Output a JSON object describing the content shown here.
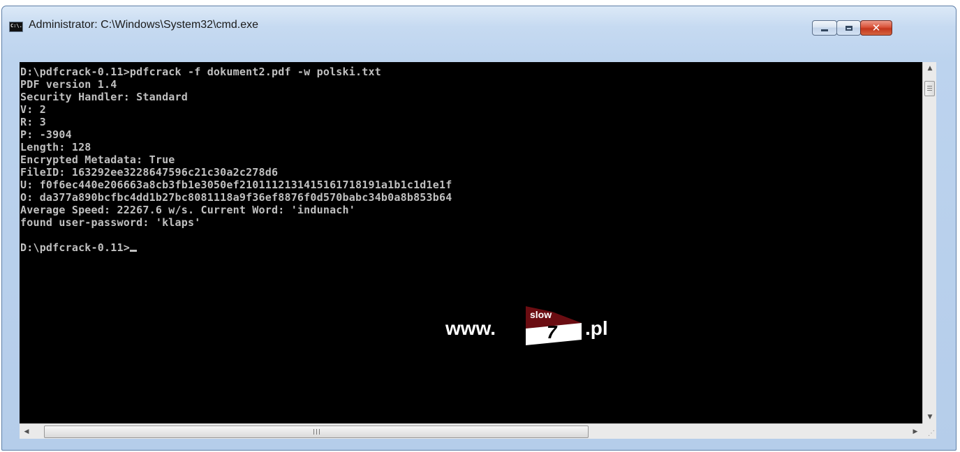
{
  "window": {
    "title": "Administrator: C:\\Windows\\System32\\cmd.exe",
    "icon_text": "C:\\.",
    "icons": {
      "app": "cmd-app-icon",
      "minimize": "minimize-icon",
      "maximize": "maximize-icon",
      "close": "close-icon"
    },
    "close_glyph": "✕",
    "colors": {
      "frame": "#bcd3ee",
      "close_button": "#c3361d",
      "console_bg": "#000000",
      "console_text": "#c0c0c0"
    }
  },
  "console": {
    "lines": [
      "D:\\pdfcrack-0.11>pdfcrack -f dokument2.pdf -w polski.txt",
      "PDF version 1.4",
      "Security Handler: Standard",
      "V: 2",
      "R: 3",
      "P: -3904",
      "Length: 128",
      "Encrypted Metadata: True",
      "FileID: 163292ee3228647596c21c30a2c278d6",
      "U: f0f6ec440e206663a8cb3fb1e3050ef2101112131415161718191a1b1c1d1e1f",
      "O: da377a890bcfbc4dd1b27bc8081118a9f36ef8876f0d570babc34b0a8b853b64",
      "Average Speed: 22267.6 w/s. Current Word: 'indunach'",
      "found user-password: 'klaps'",
      "",
      "D:\\pdfcrack-0.11>"
    ]
  },
  "watermark": {
    "prefix": "www.",
    "badge_top": "slow",
    "badge_number": "7",
    "suffix": ".pl"
  },
  "scrollbars": {
    "up_arrow": "▲",
    "down_arrow": "▼",
    "left_arrow": "◀",
    "right_arrow": "▶",
    "resize": "⋰"
  }
}
